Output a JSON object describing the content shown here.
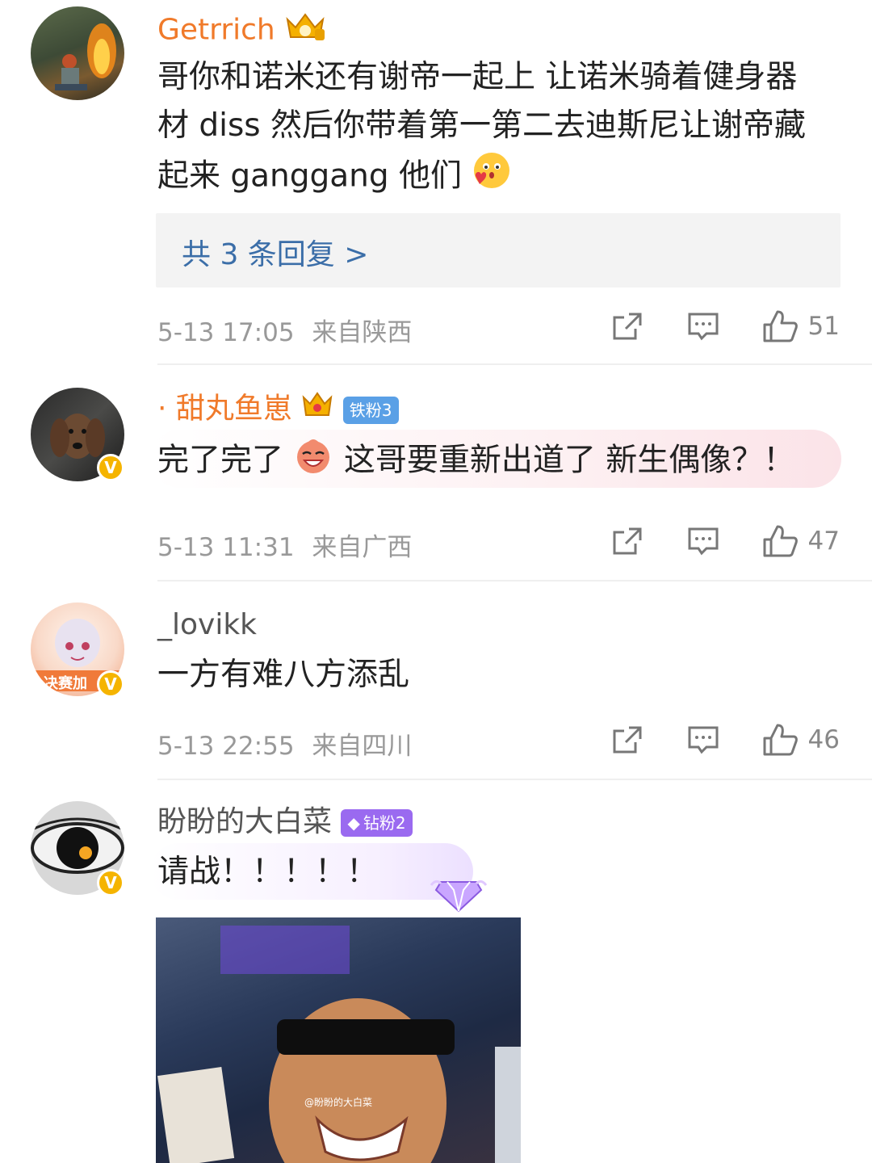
{
  "comments": [
    {
      "username": "Getrrich",
      "text": "哥你和诺米还有谢帝一起上 让诺米骑着健身器材 diss  然后你带着第一第二去迪斯尼让谢帝藏起来 ganggang 他们",
      "replies_label": "共 3 条回复 >",
      "time": "5-13 17:05",
      "location": "来自陕西",
      "likes": "51"
    },
    {
      "username": "· 甜丸鱼崽",
      "fan_badge": "铁粉3",
      "text_a": "完了完了",
      "text_b": "这哥要重新出道了 新生偶像？！",
      "time": "5-13 11:31",
      "location": "来自广西",
      "likes": "47"
    },
    {
      "username": "_lovikk",
      "avatar_text": "决赛加",
      "text": "一方有难八方添乱",
      "time": "5-13 22:55",
      "location": "来自四川",
      "likes": "46"
    },
    {
      "username": "盼盼的大白菜",
      "fan_badge": "钻粉2",
      "text": "请战！！！！！",
      "watermark": "@盼盼的大白菜"
    }
  ],
  "icons": {
    "share": "share-icon",
    "comment": "comment-icon",
    "like": "thumbs-up-icon",
    "verified": "verified-badge-icon"
  },
  "colors": {
    "username_orange": "#f07a2a",
    "link_blue": "#3b6ea8",
    "meta_gray": "#999999"
  }
}
